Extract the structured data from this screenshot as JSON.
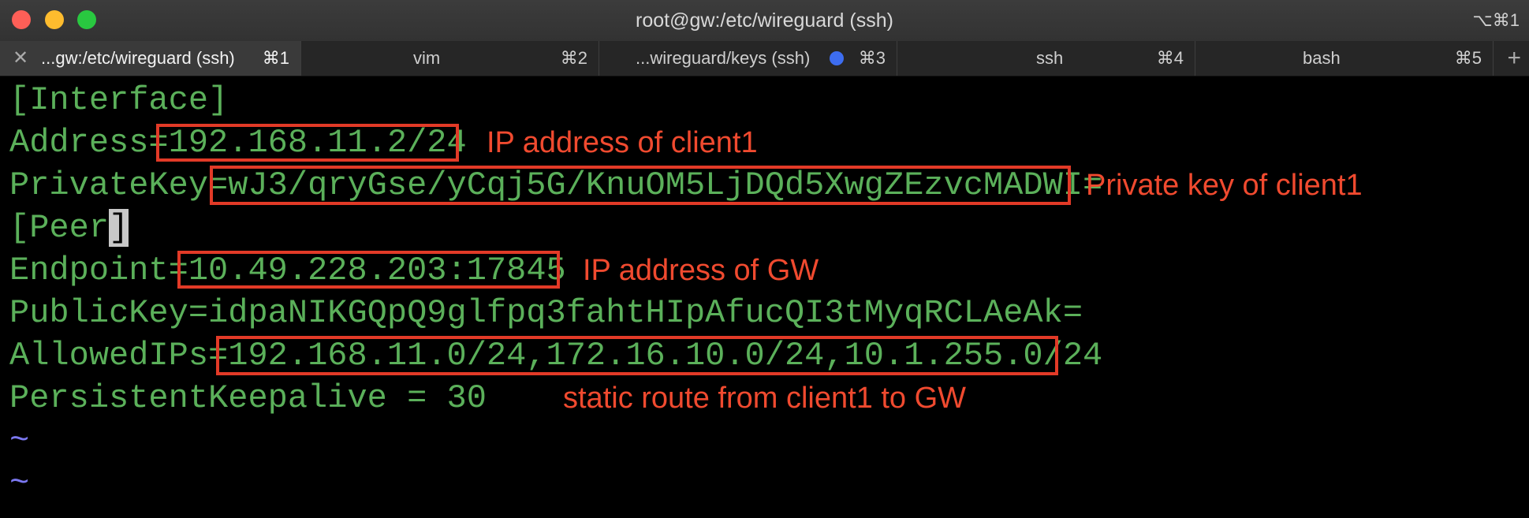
{
  "window": {
    "title": "root@gw:/etc/wireguard (ssh)",
    "shortcut": "⌥⌘1"
  },
  "tabs": [
    {
      "label": "...gw:/etc/wireguard (ssh)",
      "key": "⌘1",
      "active": true
    },
    {
      "label": "vim",
      "key": "⌘2",
      "active": false
    },
    {
      "label": "...wireguard/keys (ssh)",
      "key": "⌘3",
      "active": false,
      "activity_dot": true
    },
    {
      "label": "ssh",
      "key": "⌘4",
      "active": false
    },
    {
      "label": "bash",
      "key": "⌘5",
      "active": false
    }
  ],
  "add_tab_label": "+",
  "close_tab_label": "✕",
  "terminal": {
    "interface_header": "[Interface]",
    "address_key": "Address=",
    "address_value": "192.168.11.2/24",
    "privatekey_key": "PrivateKey=",
    "privatekey_value": "wJ3/qryGse/yCqj5G/KnuOM5LjDQd5XwgZEzvcMADWI=",
    "peer_header_text": "[Peer",
    "peer_header_cursor": "]",
    "endpoint_key": "Endpoint=",
    "endpoint_value": "10.49.228.203:17845",
    "publickey_line": "PublicKey=idpaNIKGQpQ9glfpq3fahtHIpAfucQI3tMyqRCLAeAk=",
    "allowedips_key": "AllowedIPs=",
    "allowedips_value": "192.168.11.0/24,172.16.10.0/24,10.1.255.0/24",
    "keepalive_line": "PersistentKeepalive = 30",
    "tilde": "~"
  },
  "annotations": {
    "address": "IP address of client1",
    "privatekey": "Private key of client1",
    "endpoint": "IP address of GW",
    "allowedips": "static route from client1 to GW"
  },
  "colors": {
    "terminal_text": "#5bb05a",
    "annotation": "#f04a2f",
    "tilde": "#7b78f0",
    "activity_dot": "#3d6df0"
  }
}
